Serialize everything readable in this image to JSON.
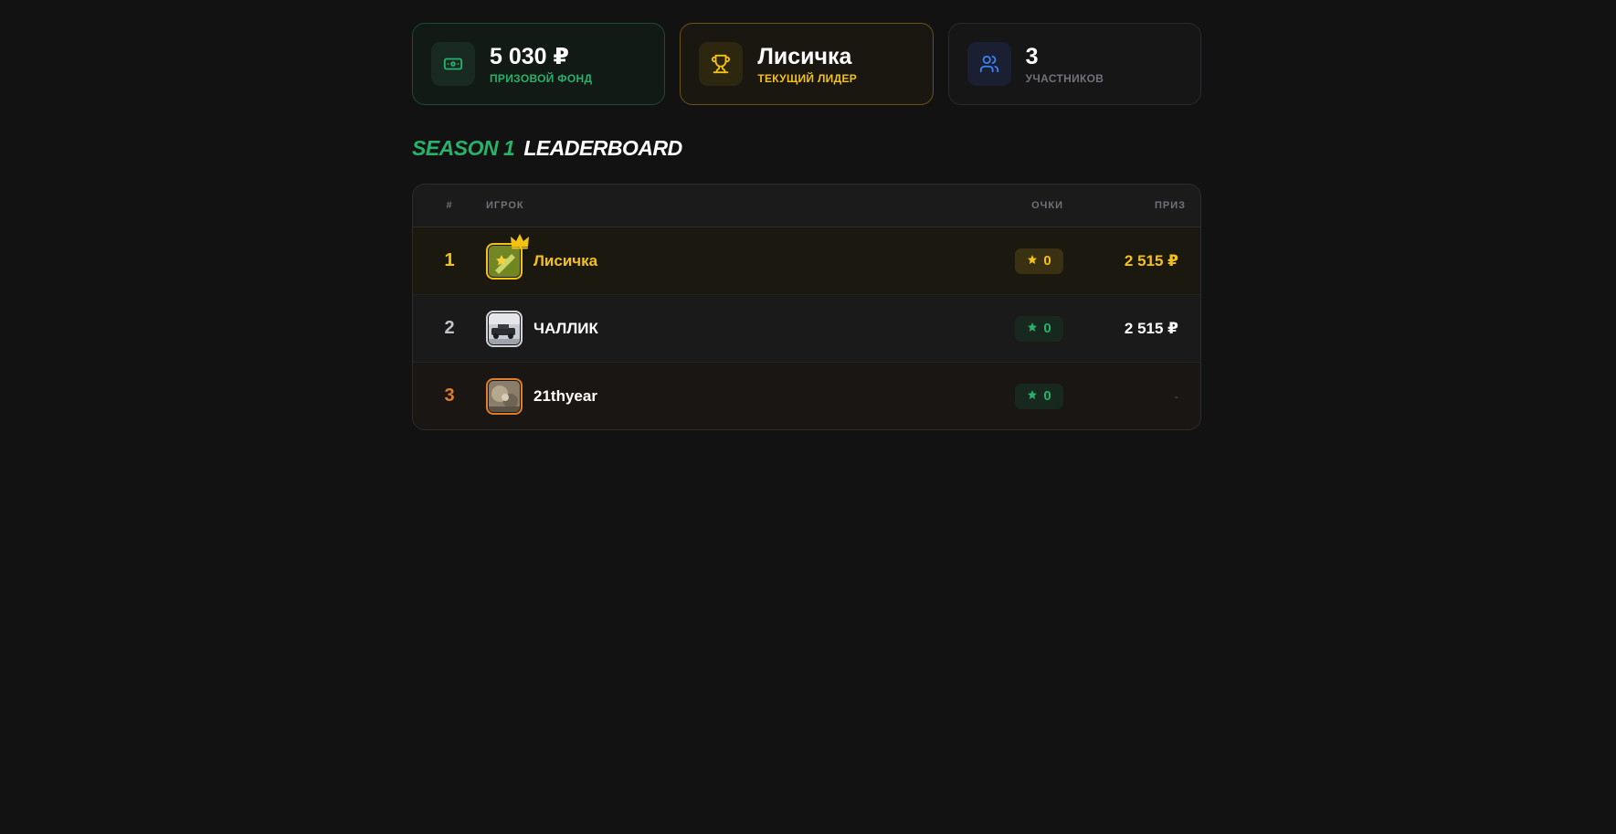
{
  "stats": {
    "prize_pool": {
      "value": "5 030 ₽",
      "label": "ПРИЗОВОЙ ФОНД",
      "icon": "banknote-icon",
      "accent": "#27b16b"
    },
    "leader": {
      "value": "Лисичка",
      "label": "ТЕКУЩИЙ ЛИДЕР",
      "icon": "trophy-icon",
      "accent": "#f3c215"
    },
    "participants": {
      "value": "3",
      "label": "УЧАСТНИКОВ",
      "icon": "users-icon",
      "accent": "#3b82f6"
    }
  },
  "heading": {
    "season": "SEASON 1",
    "title": "LEADERBOARD"
  },
  "table": {
    "headers": {
      "rank": "#",
      "player": "ИГРОК",
      "points": "ОЧКИ",
      "prize": "ПРИЗ"
    },
    "rows": [
      {
        "rank": "1",
        "name": "Лисичка",
        "points": "0",
        "prize": "2 515 ₽",
        "crown": true
      },
      {
        "rank": "2",
        "name": "ЧАЛЛИК",
        "points": "0",
        "prize": "2 515 ₽",
        "crown": false
      },
      {
        "rank": "3",
        "name": "21thyear",
        "points": "0",
        "prize": "-",
        "crown": false
      }
    ]
  }
}
